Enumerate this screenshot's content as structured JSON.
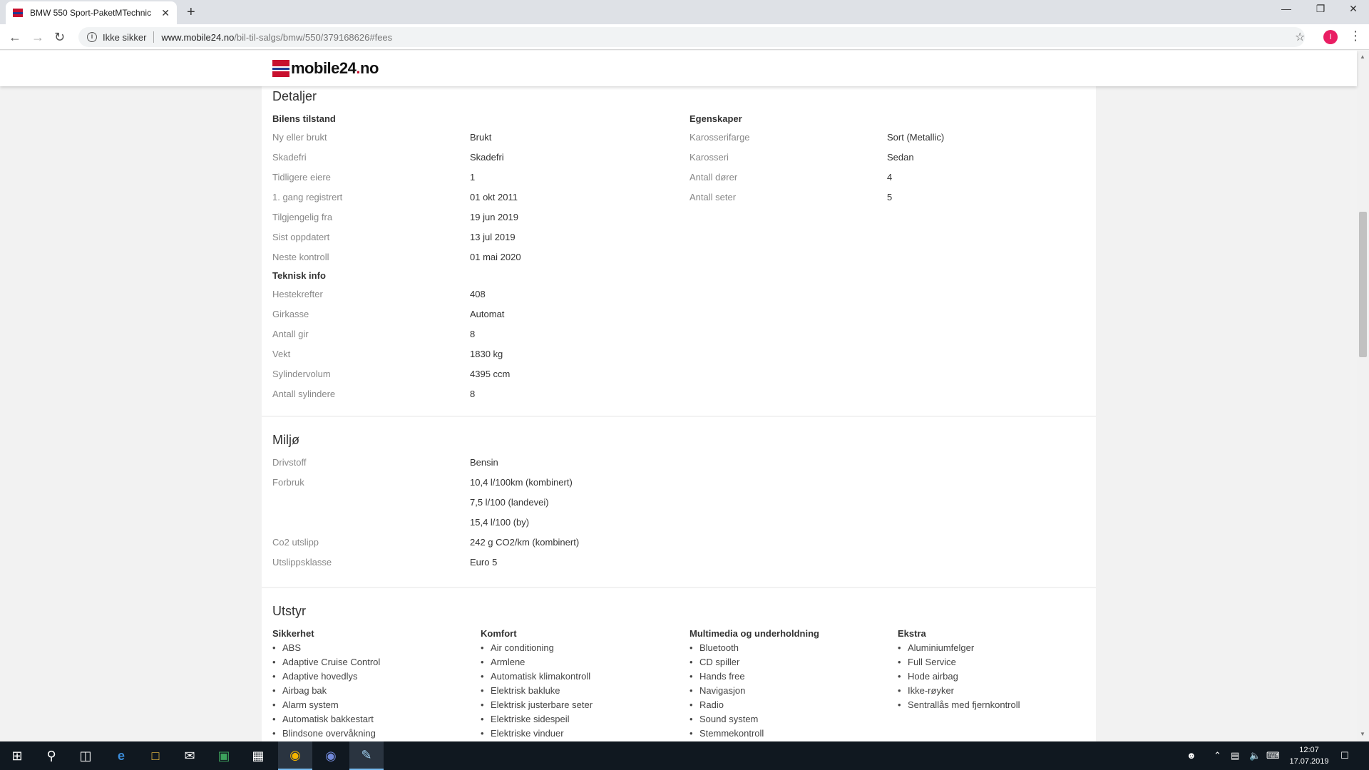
{
  "browser": {
    "tab_title": "BMW 550 Sport-PaketMTechnic",
    "tab_close": "✕",
    "new_tab": "+",
    "security_label": "Ikke sikker",
    "url_host": "www.mobile24.no",
    "url_path": "/bil-til-salgs/bmw/550/379168626#fees",
    "profile_initial": "I"
  },
  "site": {
    "logo_main": "mobile24",
    "logo_dot": ".",
    "logo_tld": "no"
  },
  "details": {
    "title": "Detaljer",
    "condition_heading": "Bilens tilstand",
    "condition_rows": [
      {
        "label": "Ny eller brukt",
        "value": "Brukt"
      },
      {
        "label": "Skadefri",
        "value": "Skadefri"
      },
      {
        "label": "Tidligere eiere",
        "value": "1"
      },
      {
        "label": "1. gang registrert",
        "value": "01 okt 2011"
      },
      {
        "label": "Tilgjengelig fra",
        "value": "19 jun 2019"
      },
      {
        "label": "Sist oppdatert",
        "value": "13 jul 2019"
      },
      {
        "label": "Neste kontroll",
        "value": "01 mai 2020"
      }
    ],
    "tech_heading": "Teknisk info",
    "tech_rows": [
      {
        "label": "Hestekrefter",
        "value": "408"
      },
      {
        "label": "Girkasse",
        "value": "Automat"
      },
      {
        "label": "Antall gir",
        "value": "8"
      },
      {
        "label": "Vekt",
        "value": "1830 kg"
      },
      {
        "label": "Sylindervolum",
        "value": "4395 ccm"
      },
      {
        "label": "Antall sylindere",
        "value": "8"
      }
    ],
    "props_heading": "Egenskaper",
    "props_rows": [
      {
        "label": "Karosserifarge",
        "value": "Sort (Metallic)"
      },
      {
        "label": "Karosseri",
        "value": "Sedan"
      },
      {
        "label": "Antall dører",
        "value": "4"
      },
      {
        "label": "Antall seter",
        "value": "5"
      }
    ]
  },
  "environment": {
    "title": "Miljø",
    "rows": [
      {
        "label": "Drivstoff",
        "value": "Bensin"
      },
      {
        "label": "Forbruk",
        "value": "10,4 l/100km (kombinert)"
      },
      {
        "label": "",
        "value": "7,5 l/100 (landevei)"
      },
      {
        "label": "",
        "value": "15,4 l/100 (by)"
      },
      {
        "label": "Co2 utslipp",
        "value": "242 g CO2/km (kombinert)"
      },
      {
        "label": "Utslippsklasse",
        "value": "Euro 5"
      }
    ]
  },
  "equipment": {
    "title": "Utstyr",
    "columns": [
      {
        "heading": "Sikkerhet",
        "items": [
          "ABS",
          "Adaptive Cruise Control",
          "Adaptive hovedlys",
          "Airbag bak",
          "Alarm system",
          "Automatisk bakkestart",
          "Blindsone overvåkning"
        ]
      },
      {
        "heading": "Komfort",
        "items": [
          "Air conditioning",
          "Armlene",
          "Automatisk klimakontroll",
          "Elektrisk bakluke",
          "Elektrisk justerbare seter",
          "Elektriske sidespeil",
          "Elektriske vinduer"
        ]
      },
      {
        "heading": "Multimedia og underholdning",
        "items": [
          "Bluetooth",
          "CD spiller",
          "Hands free",
          "Navigasjon",
          "Radio",
          "Sound system",
          "Stemmekontroll"
        ]
      },
      {
        "heading": "Ekstra",
        "items": [
          "Aluminiumfelger",
          "Full Service",
          "Hode airbag",
          "Ikke-røyker",
          "Sentrallås med fjernkontroll"
        ]
      }
    ]
  },
  "taskbar": {
    "time": "12:07",
    "date": "17.07.2019"
  }
}
